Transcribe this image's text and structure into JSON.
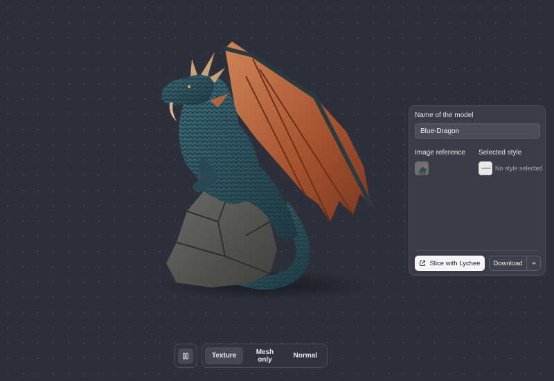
{
  "panel": {
    "name_label": "Name of the model",
    "name_value": "Blue-Dragon",
    "image_reference_label": "Image reference",
    "selected_style_label": "Selected style",
    "no_style_text": "No style selected",
    "slice_button": "Slice with Lychee",
    "download_button": "Download"
  },
  "toolbar": {
    "tabs": [
      {
        "label": "Texture",
        "active": true
      },
      {
        "label": "Mesh only",
        "active": false
      },
      {
        "label": "Normal",
        "active": false
      }
    ],
    "grid_toggle_icon": "columns-icon"
  },
  "colors": {
    "background": "#2d303b",
    "panel": "#3a3c46",
    "dragon_scales": "#2d4f5c",
    "dragon_wing": "#b5653e",
    "rock": "#5a5a58"
  }
}
